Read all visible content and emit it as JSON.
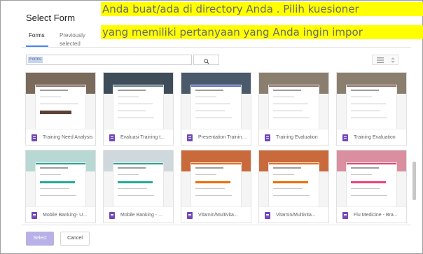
{
  "dialog": {
    "title": "Select Form",
    "tabs": [
      {
        "label": "Forms",
        "active": true
      },
      {
        "label": "Previously selected",
        "active": false
      }
    ],
    "search": {
      "chip": "Forms",
      "placeholder": ""
    },
    "buttons": {
      "select": "Select",
      "cancel": "Cancel"
    }
  },
  "overlay": {
    "line1": "Anda buat/ada di directory  Anda . Pilih kuesioner",
    "line2": "yang memiliki  pertanyaan  yang Anda ingin impor"
  },
  "colors": {
    "accent": "#4285f4",
    "forms_purple": "#7248b9",
    "select_disabled": "#b7b1e8",
    "highlight": "#ffff00"
  },
  "files": [
    {
      "name": "Training Need Analysis",
      "banner": "#7a6a5c",
      "accent": "#8d6e63"
    },
    {
      "name": "Evaluasi Training t...",
      "banner": "#3f4c5a",
      "accent": "#607d8b"
    },
    {
      "name": "Presentation Training Evaluation",
      "banner": "#4a5a6a",
      "accent": "#5c6bc0"
    },
    {
      "name": "Training Evaluation",
      "banner": "#8a7f6e",
      "accent": "#8d6e63"
    },
    {
      "name": "Training Evaluation",
      "banner": "#8a7f6e",
      "accent": "#8d6e63"
    },
    {
      "name": "Mobile Banking- U...",
      "banner": "#b8d8d4",
      "accent": "#26a69a"
    },
    {
      "name": "Mobile Banking - ...",
      "banner": "#cfd8dc",
      "accent": "#26a69a"
    },
    {
      "name": "Vitamin/Multivita...",
      "banner": "#c96a3c",
      "accent": "#ef6c00"
    },
    {
      "name": "Vitamin/Multivita...",
      "banner": "#c96a3c",
      "accent": "#ef6c00"
    },
    {
      "name": "Flu Medicine - Bra...",
      "banner": "#d98fa0",
      "accent": "#ec407a"
    }
  ]
}
